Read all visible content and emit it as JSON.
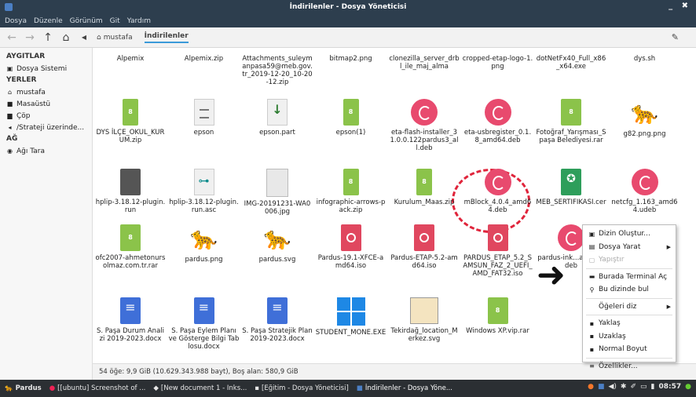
{
  "window": {
    "title": "İndirilenler - Dosya Yöneticisi",
    "controls": "_ ✖"
  },
  "menu": [
    "Dosya",
    "Düzenle",
    "Görünüm",
    "Git",
    "Yardım"
  ],
  "toolbar": {
    "home_crumb": "mustafa",
    "current_crumb": "İndirilenler"
  },
  "sidebar": {
    "devices_title": "AYGITLAR",
    "devices": [
      "Dosya Sistemi"
    ],
    "places_title": "YERLER",
    "places": [
      "mustafa",
      "Masaüstü",
      "Çöp",
      "/Strateji üzerinde..."
    ],
    "network_title": "AĞ",
    "network": [
      "Ağı Tara"
    ]
  },
  "files": [
    {
      "name": "Alpemix",
      "icon": "none"
    },
    {
      "name": "Alpemix.zip",
      "icon": "none"
    },
    {
      "name": "Attachments_suleymanpasa59@meb.gov.tr_2019-12-20_10-20-12.zip",
      "icon": "none"
    },
    {
      "name": "bitmap2.png",
      "icon": "none"
    },
    {
      "name": "clonezilla_server_drbl_ile_maj_alma",
      "icon": "none"
    },
    {
      "name": "cropped-etap-logo-1.png",
      "icon": "none"
    },
    {
      "name": "dotNetFx40_Full_x86_x64.exe",
      "icon": "none"
    },
    {
      "name": "dys.sh",
      "icon": "none"
    },
    {
      "name": "DYS İLÇE_OKUL_KURUM.zip",
      "icon": "zip"
    },
    {
      "name": "epson",
      "icon": "txtf"
    },
    {
      "name": "epson.part",
      "icon": "part"
    },
    {
      "name": "epson(1)",
      "icon": "zip"
    },
    {
      "name": "eta-flash-installer_31.0.0.122pardus3_all.deb",
      "icon": "deb"
    },
    {
      "name": "eta-usbregister_0.1.8_amd64.deb",
      "icon": "deb"
    },
    {
      "name": "Fotoğraf_Yarışması_Spaşa Belediyesi.rar",
      "icon": "rar"
    },
    {
      "name": "g82.png.png",
      "icon": "cat"
    },
    {
      "name": "hplip-3.18.12-plugin.run",
      "icon": "run"
    },
    {
      "name": "hplip-3.18.12-plugin.run.asc",
      "icon": "asc"
    },
    {
      "name": "IMG-20191231-WA0006.jpg",
      "icon": "jpg"
    },
    {
      "name": "infographic-arrows-pack.zip",
      "icon": "zip"
    },
    {
      "name": "Kurulum_Maas.zip",
      "icon": "zip"
    },
    {
      "name": "mBlock_4.0.4_amd64.deb",
      "icon": "deb"
    },
    {
      "name": "MEB_SERTIFIKASI.cer",
      "icon": "cert"
    },
    {
      "name": "netcfg_1.163_amd64.udeb",
      "icon": "deb"
    },
    {
      "name": "ofc2007-ahmetonursolmaz.com.tr.rar",
      "icon": "rar"
    },
    {
      "name": "pardus.png",
      "icon": "cat"
    },
    {
      "name": "pardus.svg",
      "icon": "cat"
    },
    {
      "name": "Pardus-19.1-XFCE-amd64.iso",
      "icon": "iso"
    },
    {
      "name": "Pardus-ETAP-5.2-amd64.iso",
      "icon": "iso"
    },
    {
      "name": "PARDUS_ETAP_5.2_SAMSUN_FAZ_2_UEFI_AMD_FAT32.iso",
      "icon": "iso"
    },
    {
      "name": "pardus-ink...amd64.deb",
      "icon": "deb"
    },
    {
      "name": "",
      "icon": "none"
    },
    {
      "name": "S. Paşa Durum Analizi 2019-2023.docx",
      "icon": "doc"
    },
    {
      "name": "S. Paşa Eylem Planı ve Gösterge Bilgi Tablosu.docx",
      "icon": "doc"
    },
    {
      "name": "S. Paşa Stratejik Plan 2019-2023.docx",
      "icon": "doc"
    },
    {
      "name": "STUDENT_MONE.EXE",
      "icon": "exe"
    },
    {
      "name": "Tekirdağ_location_Merkez.svg",
      "icon": "svgf"
    },
    {
      "name": "Windows XP.vip.rar",
      "icon": "rar"
    }
  ],
  "status": "54 öğe: 9,9 GiB (10.629.343.988 bayt), Boş alan: 580,9 GiB",
  "context_menu": [
    {
      "label": "Dizin Oluştur...",
      "icon": "folder-plus-icon",
      "submenu": false,
      "disabled": false
    },
    {
      "label": "Dosya Yarat",
      "icon": "file-new-icon",
      "submenu": true,
      "disabled": false
    },
    {
      "label": "Yapıştır",
      "icon": "paste-icon",
      "submenu": false,
      "disabled": true
    },
    {
      "label": "Burada Terminal Aç",
      "icon": "terminal-icon",
      "submenu": false,
      "disabled": false
    },
    {
      "label": "Bu dizinde bul",
      "icon": "search-icon",
      "submenu": false,
      "disabled": false
    },
    {
      "label": "Öğeleri diz",
      "icon": "none",
      "submenu": true,
      "disabled": false
    },
    {
      "label": "Yaklaş",
      "icon": "zoom-in-icon",
      "submenu": false,
      "disabled": false
    },
    {
      "label": "Uzaklaş",
      "icon": "zoom-out-icon",
      "submenu": false,
      "disabled": false
    },
    {
      "label": "Normal Boyut",
      "icon": "zoom-reset-icon",
      "submenu": false,
      "disabled": false
    },
    {
      "label": "Özellikler...",
      "icon": "properties-icon",
      "submenu": false,
      "disabled": false
    }
  ],
  "taskbar": {
    "start": "Pardus",
    "tasks": [
      "[[ubuntu] Screenshot of ...",
      "[New document 1 - Inks...",
      "[Eğitim - Dosya Yöneticisi]",
      "İndirilenler - Dosya Yöne..."
    ],
    "clock": "08:57"
  }
}
